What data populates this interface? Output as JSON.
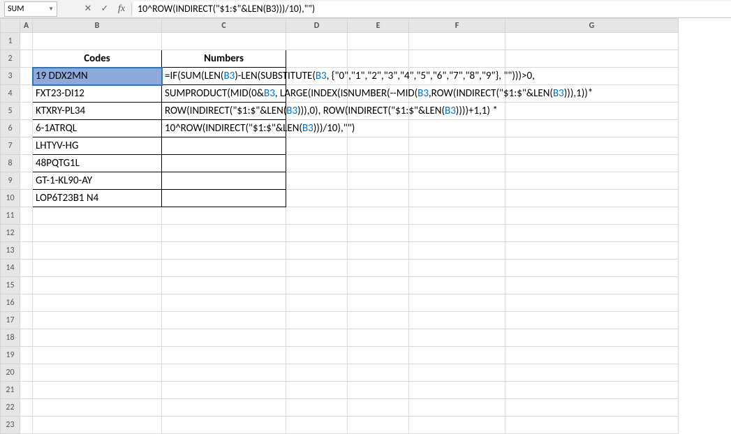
{
  "nameBox": "SUM",
  "formulaBarText": "10^ROW(INDIRECT(\"$1:$\"&LEN(B3)))/10),\"\")",
  "headers": {
    "codes": "Codes",
    "numbers": "Numbers"
  },
  "rows": {
    "r3": "19 DDX2MN",
    "r4": "FXT23-DI12",
    "r5": "KTXRY-PL34",
    "r6": "6-1ATRQL",
    "r7": "LHTYV-HG",
    "r8": "48PQTG1L",
    "r9": "GT-1-KL90-AY",
    "r10": "LOP6T23B1 N4"
  },
  "formulaLines": {
    "l1a": "=IF(SUM(LEN(",
    "l1b": ")-LEN(SUBSTITUTE(",
    "l1c": ", {\"0\",\"1\",\"2\",\"3\",\"4\",\"5\",\"6\",\"7\",\"8\",\"9\"}, \"\")))>0,",
    "l2a": "SUMPRODUCT(MID(0&",
    "l2b": ", LARGE(INDEX(ISNUMBER(--MID(",
    "l2c": ",ROW(INDIRECT(\"$1:$\"&LEN(",
    "l2d": "))),1))*",
    "l3a": "ROW(INDIRECT(\"$1:$\"&LEN(",
    "l3b": "))),0), ROW(INDIRECT(\"$1:$\"&LEN(",
    "l3c": "))))+1,1) *",
    "l4a": "10^ROW(INDIRECT(\"$1:$\"&LEN(",
    "l4b": ")))/10),\"\")"
  },
  "ref": "B3",
  "cols": [
    "A",
    "B",
    "C",
    "D",
    "E",
    "F",
    "G"
  ],
  "rowNums": [
    1,
    2,
    3,
    4,
    5,
    6,
    7,
    8,
    9,
    10,
    11,
    12,
    13,
    14,
    15,
    16,
    17,
    18,
    19,
    20,
    21,
    22,
    23
  ]
}
